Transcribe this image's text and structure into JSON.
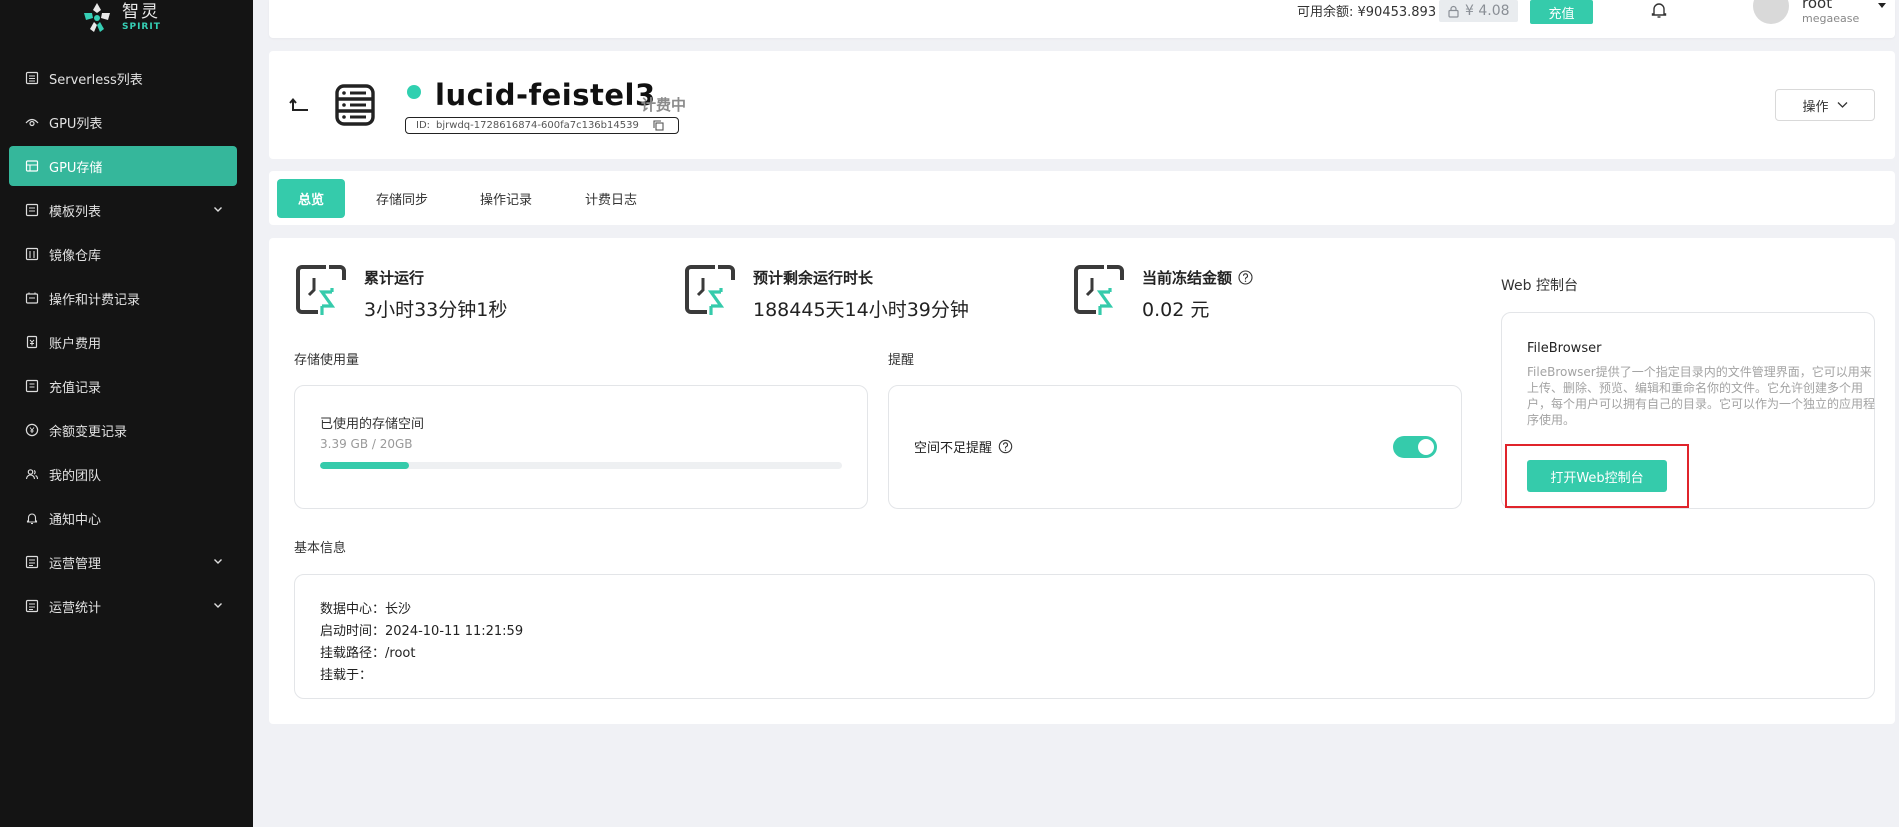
{
  "brand": {
    "name_cn": "智灵",
    "name_en": "SPIRIT",
    "accent": "#35cbab",
    "sidebar_bg": "#141414"
  },
  "sidebar": {
    "items": [
      {
        "label": "Serverless列表",
        "icon": "list-icon"
      },
      {
        "label": "GPU列表",
        "icon": "gpu-icon"
      },
      {
        "label": "GPU存储",
        "icon": "storage-icon",
        "active": true
      },
      {
        "label": "模板列表",
        "icon": "template-icon",
        "expandable": true
      },
      {
        "label": "镜像仓库",
        "icon": "image-repo-icon"
      },
      {
        "label": "操作和计费记录",
        "icon": "record-icon"
      },
      {
        "label": "账户费用",
        "icon": "bill-icon"
      },
      {
        "label": "充值记录",
        "icon": "recharge-icon"
      },
      {
        "label": "余额变更记录",
        "icon": "yen-icon"
      },
      {
        "label": "我的团队",
        "icon": "team-icon"
      },
      {
        "label": "通知中心",
        "icon": "bell-icon"
      },
      {
        "label": "运营管理",
        "icon": "ops-icon",
        "expandable": true
      },
      {
        "label": "运营统计",
        "icon": "stats-icon",
        "expandable": true
      }
    ]
  },
  "topbar": {
    "balance": "可用余额: ¥90453.893",
    "frozen": "¥ 4.08",
    "recharge": "充值",
    "user": {
      "name": "root",
      "org": "megaease"
    }
  },
  "instance": {
    "name": "lucid-feistel3",
    "state": "计费中",
    "id_label": "ID:",
    "id": "bjrwdq-1728616874-600fa7c136b14539",
    "actions": "操作",
    "status_color": "#30d0b0"
  },
  "tabs": [
    "总览",
    "存储同步",
    "操作记录",
    "计费日志"
  ],
  "stats": [
    {
      "label": "累计运行",
      "value": "3小时33分钟1秒"
    },
    {
      "label": "预计剩余运行时长",
      "value": "188445天14小时39分钟"
    },
    {
      "label": "当前冻结金额",
      "value": "0.02 元",
      "help": true
    }
  ],
  "storage": {
    "section": "存储使用量",
    "label": "已使用的存储空间",
    "value": "3.39 GB / 20GB",
    "used_fraction": 0.17
  },
  "reminder": {
    "section": "提醒",
    "label": "空间不足提醒",
    "enabled": true
  },
  "web_console": {
    "section": "Web 控制台",
    "app": "FileBrowser",
    "description": "FileBrowser提供了一个指定目录内的文件管理界面，它可以用来上传、删除、预览、编辑和重命名你的文件。它允许创建多个用户，每个用户可以拥有自己的目录。它可以作为一个独立的应用程序使用。",
    "button": "打开Web控制台"
  },
  "basic_info": {
    "section": "基本信息",
    "lines": [
      {
        "k": "数据中心：",
        "v": "长沙"
      },
      {
        "k": "启动时间：",
        "v": "2024-10-11 11:21:59"
      },
      {
        "k": "挂载路径：",
        "v": "/root"
      },
      {
        "k": "挂载于：",
        "v": ""
      }
    ]
  }
}
